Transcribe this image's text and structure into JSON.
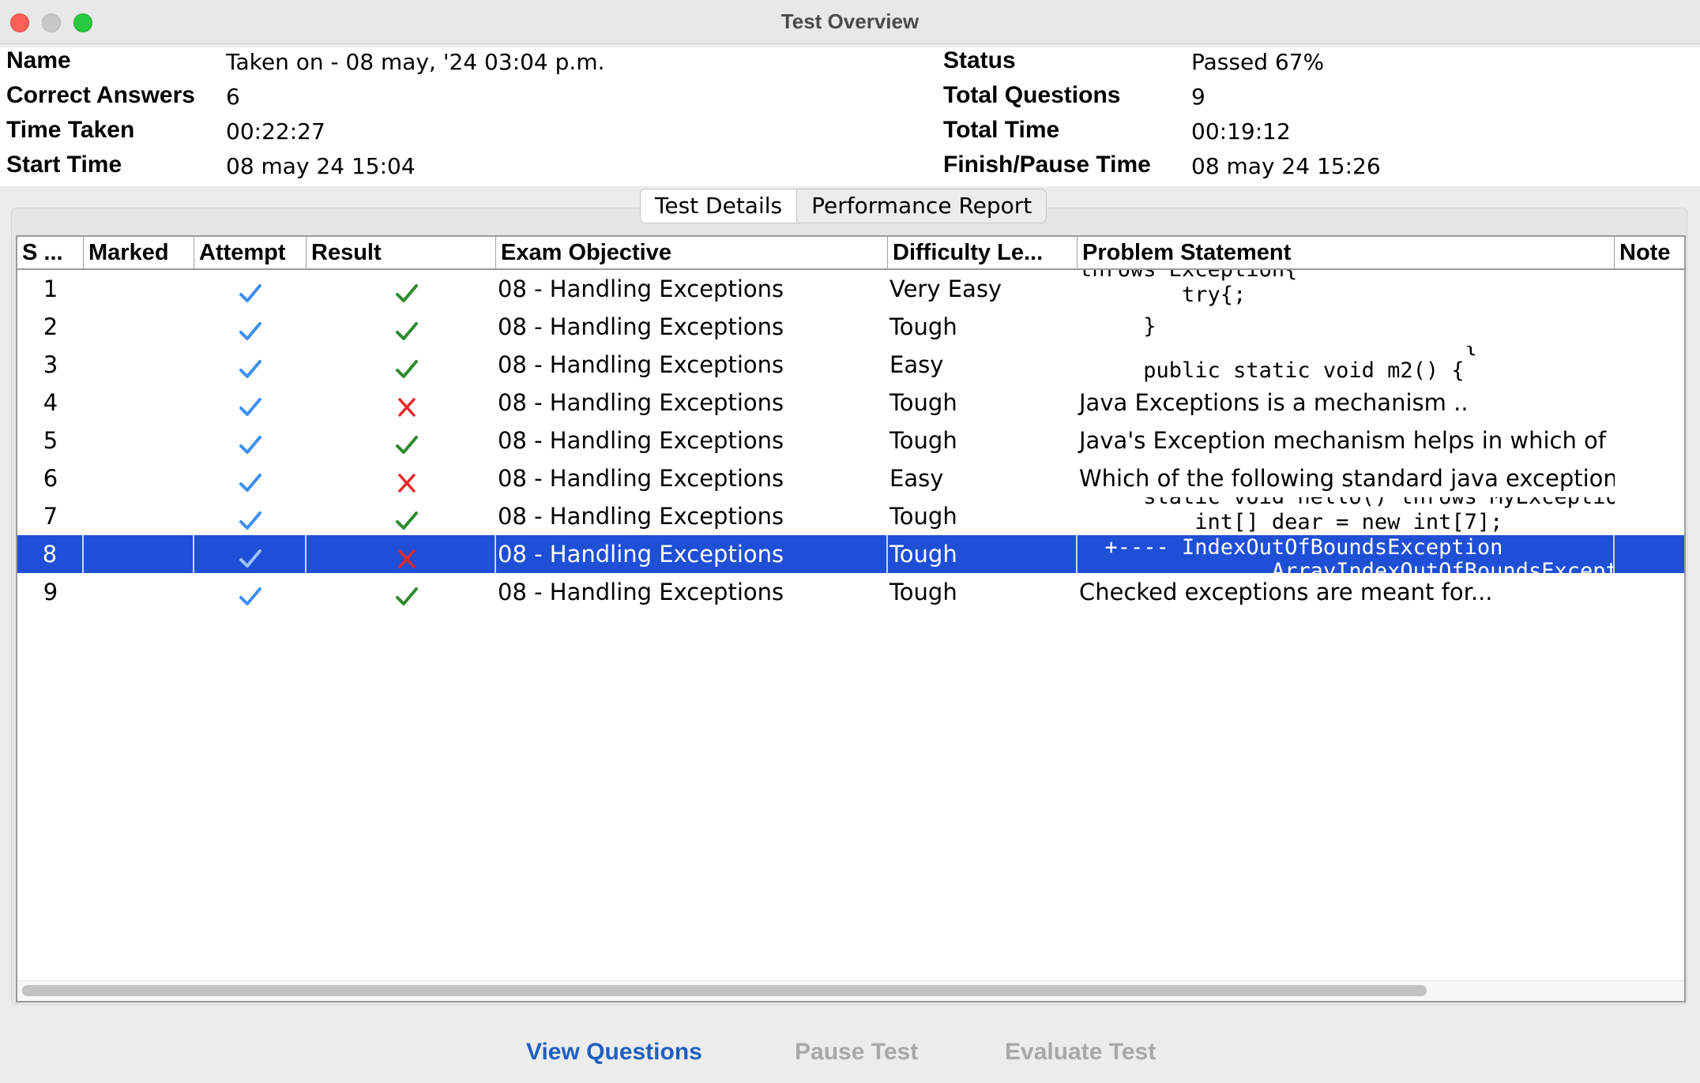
{
  "window": {
    "title": "Test Overview"
  },
  "summary": {
    "name_label": "Name",
    "name_value": "Taken on - 08 may, '24 03:04 p.m.",
    "correct_label": "Correct Answers",
    "correct_value": "6",
    "time_taken_label": "Time Taken",
    "time_taken_value": "00:22:27",
    "start_label": "Start Time",
    "start_value": "08 may 24 15:04",
    "status_label": "Status",
    "status_value": "Passed 67%",
    "total_q_label": "Total Questions",
    "total_q_value": "9",
    "total_time_label": "Total Time",
    "total_time_value": "00:19:12",
    "finish_label": "Finish/Pause Time",
    "finish_value": "08 may 24 15:26"
  },
  "tabs": [
    "Test Details",
    "Performance Report"
  ],
  "table": {
    "columns": [
      "S ...",
      "Marked",
      "Attempt",
      "Result",
      "Exam Objective",
      "Difficulty Le...",
      "Problem Statement",
      "Note"
    ],
    "rows": [
      {
        "sn": "1",
        "attempt": "check",
        "result": "check",
        "objective": "08 - Handling Exceptions",
        "difficulty": "Very Easy",
        "problem": "",
        "code": [
          "throws Exception{",
          "        try{",
          "            ;"
        ],
        "note": ""
      },
      {
        "sn": "2",
        "attempt": "check",
        "result": "check",
        "objective": "08 - Handling Exceptions",
        "difficulty": "Tough",
        "problem": "",
        "code": [
          "     }"
        ],
        "note": ""
      },
      {
        "sn": "3",
        "attempt": "check",
        "result": "check",
        "objective": "08 - Handling Exceptions",
        "difficulty": "Easy",
        "problem": "",
        "code": [
          "                              {",
          "     public static void m2() {"
        ],
        "note": ""
      },
      {
        "sn": "4",
        "attempt": "check",
        "result": "cross",
        "objective": "08 - Handling Exceptions",
        "difficulty": "Tough",
        "problem": "Java Exceptions is a mechanism ..",
        "code": [],
        "note": ""
      },
      {
        "sn": "5",
        "attempt": "check",
        "result": "check",
        "objective": "08 - Handling Exceptions",
        "difficulty": "Tough",
        "problem": "Java's Exception mechanism helps in which of",
        "code": [],
        "note": ""
      },
      {
        "sn": "6",
        "attempt": "check",
        "result": "cross",
        "objective": "08 - Handling Exceptions",
        "difficulty": "Easy",
        "problem": "Which of the following standard java exception",
        "code": [],
        "note": ""
      },
      {
        "sn": "7",
        "attempt": "check",
        "result": "check",
        "objective": "08 - Handling Exceptions",
        "difficulty": "Tough",
        "problem": "",
        "code": [
          "     static void hello() throws MyException{",
          "         int[] dear = new int[7];"
        ],
        "note": ""
      },
      {
        "sn": "8",
        "attempt": "check",
        "result": "cross",
        "objective": "08 - Handling Exceptions",
        "difficulty": "Tough",
        "problem": "",
        "code": [
          "  +---- IndexOutOfBoundsException",
          "               ArrayIndexOutOfBoundsException"
        ],
        "note": "",
        "selected": true
      },
      {
        "sn": "9",
        "attempt": "check",
        "result": "check",
        "objective": "08 - Handling Exceptions",
        "difficulty": "Tough",
        "problem": "Checked exceptions are meant for...",
        "code": [],
        "note": ""
      }
    ]
  },
  "actions": {
    "view_questions": "View Questions",
    "pause_test": "Pause Test",
    "evaluate_test": "Evaluate Test"
  },
  "colors": {
    "attempt_check": "#3d8ff0",
    "result_check": "#2e8b2e",
    "result_cross": "#e02a2a",
    "selection": "#1f4fd6",
    "link_enabled": "#1f5fbf",
    "link_disabled": "#a8a8a8"
  }
}
